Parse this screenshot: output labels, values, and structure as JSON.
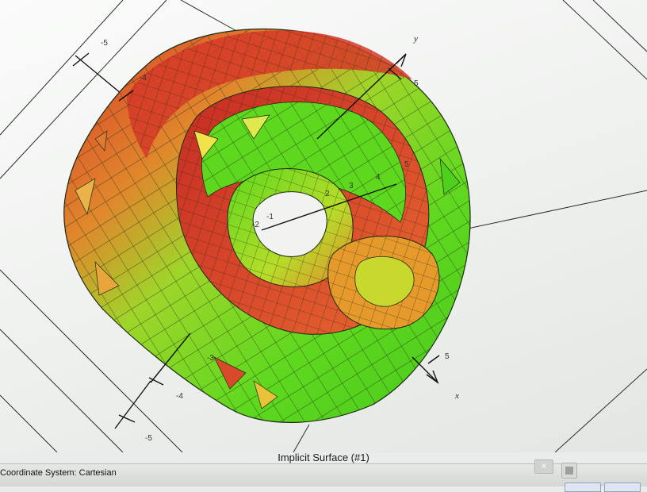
{
  "plot": {
    "title": "Implicit Surface (#1)",
    "axis_names": {
      "x": "x",
      "y": "y"
    },
    "tick_labels": {
      "upper_left": [
        "-5",
        "-4"
      ],
      "lower_left": [
        "-5",
        "-4",
        "-3"
      ],
      "inner": [
        "-2",
        "-1",
        "2",
        "3",
        "4",
        "5"
      ],
      "y_axis": [
        "5"
      ],
      "x_axis": [
        "5"
      ]
    },
    "colors": {
      "surface_high": "#d93a2a",
      "surface_mid": "#e9a02a",
      "surface_low": "#7ed321",
      "surface_bright": "#55e01c",
      "background": "#f3f4f2"
    }
  },
  "status_bar": {
    "coordinate_system": "Coordinate System: Cartesian",
    "close_symbol": "×"
  },
  "icons": [
    "close-icon",
    "toolbar-icon"
  ]
}
